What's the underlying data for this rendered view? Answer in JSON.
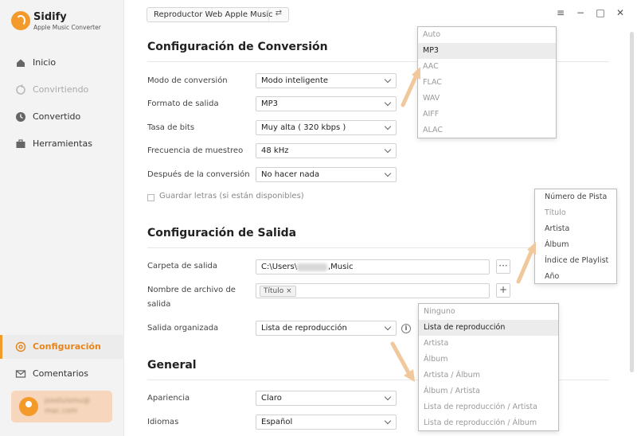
{
  "app": {
    "name": "Sidify",
    "subtitle": "Apple Music Converter"
  },
  "sidebar": {
    "items": [
      {
        "label": "Inicio",
        "icon": "home-icon",
        "state": "normal"
      },
      {
        "label": "Convirtiendo",
        "icon": "sync-icon",
        "state": "disabled"
      },
      {
        "label": "Convertido",
        "icon": "clock-icon",
        "state": "normal"
      },
      {
        "label": "Herramientas",
        "icon": "toolbox-icon",
        "state": "normal"
      }
    ],
    "bottom_items": [
      {
        "label": "Configuración",
        "icon": "gear-icon",
        "state": "active"
      },
      {
        "label": "Comentarios",
        "icon": "mail-icon",
        "state": "normal"
      }
    ],
    "user": {
      "email_line1": "joseluismu@",
      "email_line2": "mac.com"
    }
  },
  "topbar": {
    "source_label": "Reproductor Web Apple Music",
    "swap_icon": "swap-icon",
    "menu_icon": "≡",
    "minimize_icon": "−",
    "maximize_icon": "□",
    "close_icon": "✕"
  },
  "conversion": {
    "title": "Configuración de Conversión",
    "fields": {
      "mode": {
        "label": "Modo de conversión",
        "value": "Modo inteligente"
      },
      "format": {
        "label": "Formato de salida",
        "value": "MP3"
      },
      "bitrate": {
        "label": "Tasa de bits",
        "value": "Muy alta ( 320 kbps )"
      },
      "samplerate": {
        "label": "Frecuencia de muestreo",
        "value": "48 kHz"
      },
      "after": {
        "label": "Después de la conversión",
        "value": "No hacer nada"
      }
    },
    "save_lyrics_label": "Guardar letras (si están disponibles)"
  },
  "output": {
    "title": "Configuración de Salida",
    "folder": {
      "label": "Carpeta de salida",
      "value_prefix": "C:\\Users\\",
      "value_suffix": ",Music",
      "browse_label": "···"
    },
    "filename": {
      "label_line1": "Nombre de archivo de",
      "label_line2": "salida",
      "tag": "Título",
      "tag_remove": "×",
      "add_label": "+"
    },
    "organized": {
      "label": "Salida organizada",
      "value": "Lista de reproducción",
      "info_label": "i"
    }
  },
  "general": {
    "title": "General",
    "appearance": {
      "label": "Apariencia",
      "value": "Claro"
    },
    "language": {
      "label": "Idiomas",
      "value": "Español"
    }
  },
  "format_dropdown": {
    "options": [
      "Auto",
      "MP3",
      "AAC",
      "FLAC",
      "WAV",
      "AIFF",
      "ALAC"
    ],
    "selected": "MP3"
  },
  "filename_dropdown": {
    "options": [
      "Número de Pista",
      "Título",
      "Artista",
      "Álbum",
      "Índice de Playlist",
      "Año"
    ],
    "muted": [
      "Título"
    ]
  },
  "organized_dropdown": {
    "options": [
      "Ninguno",
      "Lista de reproducción",
      "Artista",
      "Álbum",
      "Artista / Álbum",
      "Álbum / Artista",
      "Lista de reproducción / Artista",
      "Lista de reproducción / Álbum"
    ],
    "selected": "Lista de reproducción"
  },
  "colors": {
    "accent": "#f39a2a",
    "active_text": "#e8841c",
    "arrow": "#f0c89c"
  }
}
